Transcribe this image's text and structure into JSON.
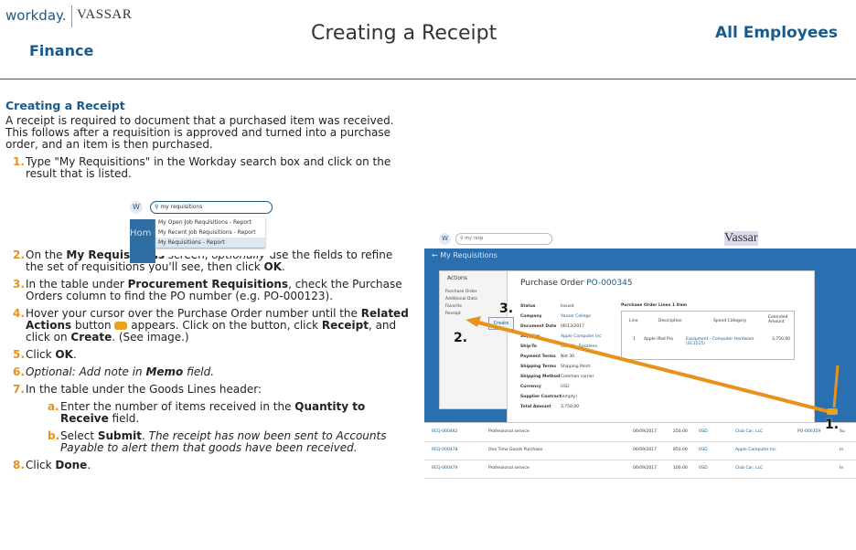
{
  "header": {
    "workday_logo": "workday.",
    "vassar_logo": "VASSAR",
    "department": "Finance",
    "doc_title": "Creating a Receipt",
    "audience": "All Employees"
  },
  "section_title": "Creating a Receipt",
  "intro": "A receipt is required to document that a purchased item was received. This follows after a requisition is approved and turned into a purchase order, and an item is then purchased.",
  "steps": [
    {
      "num": "1.",
      "text": "Type \"My Requisitions\" in the Workday search box and click on the result that is listed."
    },
    {
      "num": "2.",
      "a": "On the ",
      "b": "My Requisitions",
      "c": " screen, ",
      "d": "optionally",
      "e": " use the fields to refine the set of requisitions you'll see, then click ",
      "f": "OK",
      "g": "."
    },
    {
      "num": "3.",
      "a": "In the table under ",
      "b": "Procurement Requisitions",
      "c": ", check the Purchase Orders column to find the PO number (e.g. PO-000123)."
    },
    {
      "num": "4.",
      "a": "Hover your cursor over the Purchase Order number until the ",
      "b": "Related Actions",
      "c": " button ",
      "d": " appears. Click on the button, click ",
      "e": "Receipt",
      "f": ", and click on ",
      "g": "Create",
      "h": ". (See image.)"
    },
    {
      "num": "5.",
      "a": "Click ",
      "b": "OK",
      "c": "."
    },
    {
      "num": "6.",
      "a": "Optional: Add note in ",
      "b": "Memo",
      "c": " field."
    },
    {
      "num": "7.",
      "a": "In the table under the Goods Lines header:"
    },
    {
      "num": "8.",
      "a": "Click ",
      "b": "Done",
      "c": "."
    }
  ],
  "substeps": [
    {
      "num": "a.",
      "a": "Enter the number of items received in the ",
      "b": "Quantity to Receive",
      "c": " field."
    },
    {
      "num": "b.",
      "a": "Select ",
      "b": "Submit",
      "c": ". ",
      "d": "The receipt has now been sent to Accounts Payable to alert them that goods have been received."
    }
  ],
  "search_image": {
    "query": "my requisitions",
    "side_text": "Hom",
    "items": [
      "My Open Job Requisitions - Report",
      "My Recent Job Requisitions - Report",
      "My Requisitions - Report"
    ]
  },
  "screenshot": {
    "search": "my reqs",
    "brand": "Vassar",
    "page_title": "← My Requisitions",
    "actions_title": "Actions",
    "actions": [
      "Purchase Order",
      "Additional Data",
      "Favorite",
      "Receipt"
    ],
    "create_label": "Create",
    "po_label": "Purchase Order",
    "po_number": "PO-000345",
    "fields": [
      {
        "label": "Status",
        "value": "Issued",
        "link": false
      },
      {
        "label": "Company",
        "value": "Vassar College",
        "link": true
      },
      {
        "label": "Document Date",
        "value": "06/13/2017",
        "link": false
      },
      {
        "label": "Supplier",
        "value": "Apple Computer Inc",
        "link": true
      },
      {
        "label": "Ship-To",
        "value": "Cardillo, Rosaleen",
        "link": true
      },
      {
        "label": "Payment Terms",
        "value": "Net 30",
        "link": false
      },
      {
        "label": "Shipping Terms",
        "value": "Shipping Point",
        "link": false
      },
      {
        "label": "Shipping Method",
        "value": "Common carrier",
        "link": false
      },
      {
        "label": "Currency",
        "value": "USD",
        "link": true
      },
      {
        "label": "Supplier Contract",
        "value": "(empty)",
        "link": false
      },
      {
        "label": "Total Amount",
        "value": "3,750.00",
        "link": false
      }
    ],
    "lines_title": "Purchase Order Lines 1 item",
    "lines_headers": [
      "Line",
      "Description",
      "Spend Category",
      "Extended Amount"
    ],
    "lines_row": [
      "1",
      "Apple iPad Pro",
      "Equipment - Computer Hardware (SC1515)",
      "3,750.00"
    ],
    "grid_rows": [
      [
        "REQ-000482",
        "Professional service",
        "06/09/2017",
        "250.00",
        "USD",
        "Club Car, LLC",
        "PO-000359",
        "Su"
      ],
      [
        "REQ-000478",
        "One Time Goods Purchase",
        "06/09/2017",
        "850.00",
        "USD",
        "Apple Computer Inc",
        "",
        "In"
      ],
      [
        "REQ-000479",
        "Professional service",
        "06/09/2017",
        "100.00",
        "USD",
        "Club Car, LLC",
        "",
        "In"
      ]
    ],
    "labels": [
      "1.",
      "2.",
      "3."
    ]
  },
  "colors": {
    "brand_blue": "#1a5a8a",
    "accent_orange": "#e8911b",
    "workday_blue": "#2a70b0"
  }
}
